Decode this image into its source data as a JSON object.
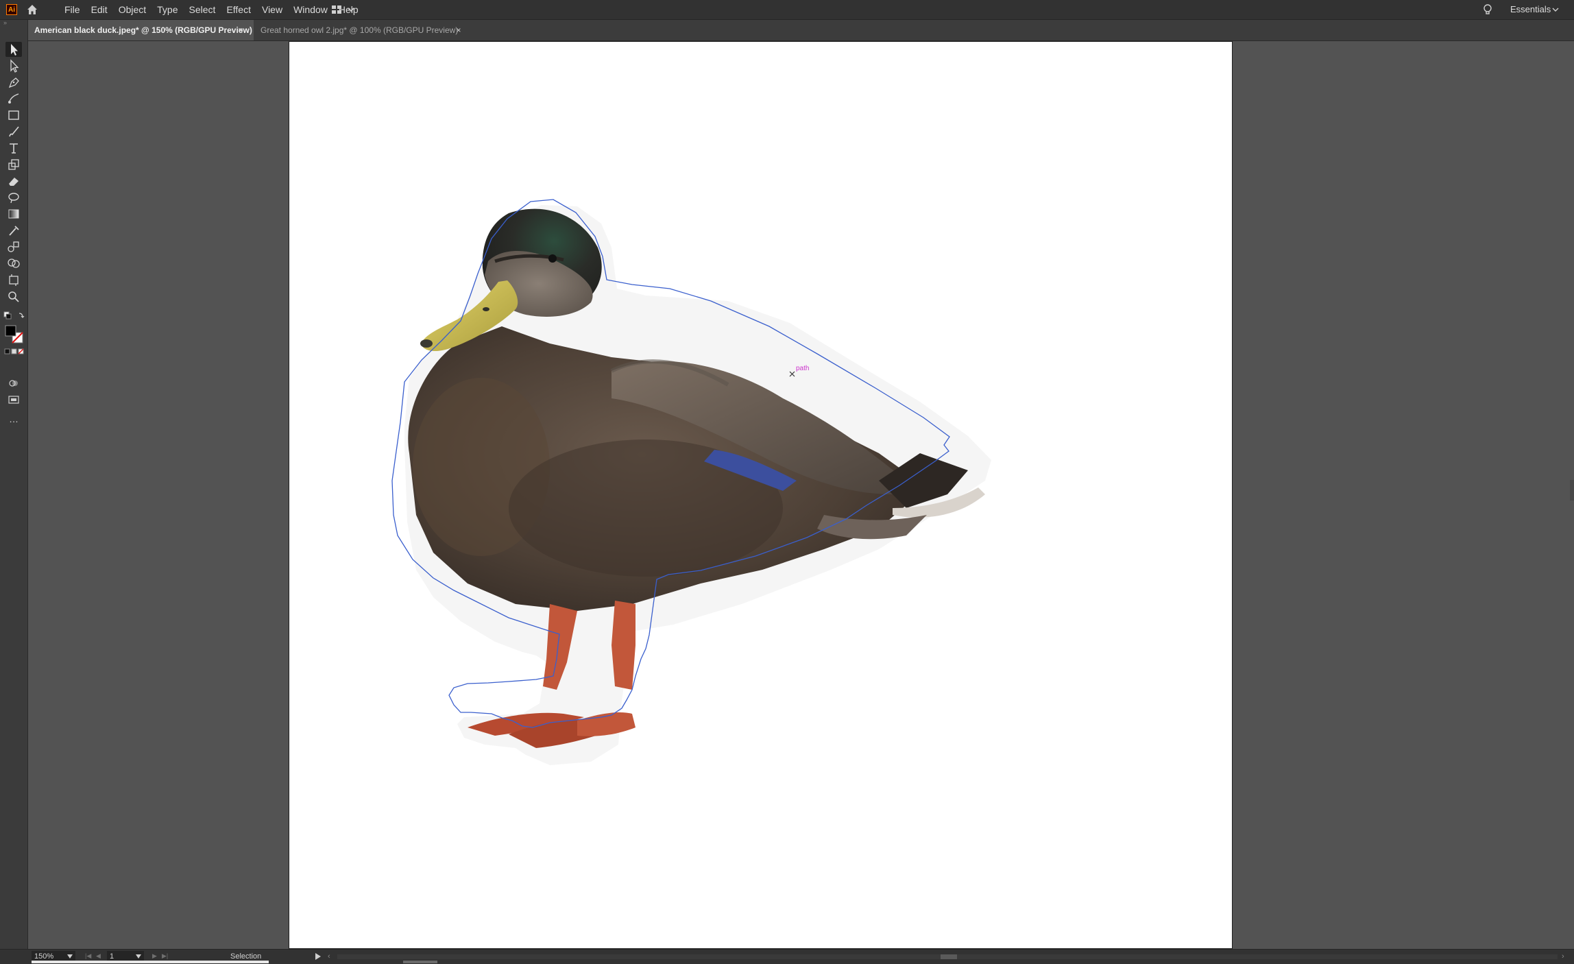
{
  "app": {
    "logo_text": "Ai",
    "workspace": "Essentials"
  },
  "menu": [
    "File",
    "Edit",
    "Object",
    "Type",
    "Select",
    "Effect",
    "View",
    "Window",
    "Help"
  ],
  "tabs": [
    {
      "label": "American black duck.jpeg* @ 150% (RGB/GPU Preview)",
      "active": true,
      "close": "×"
    },
    {
      "label": "Great horned owl 2.jpg* @ 100% (RGB/GPU Preview)",
      "active": false,
      "close": "×"
    }
  ],
  "toolbar": {
    "grip": "»",
    "tools": [
      "selection-tool-icon",
      "direct-selection-tool-icon",
      "pen-tool-icon",
      "curvature-tool-icon",
      "rectangle-tool-icon",
      "paintbrush-tool-icon",
      "type-tool-icon",
      "scale-tool-icon",
      "eraser-tool-icon",
      "lasso-tool-icon",
      "gradient-tool-icon",
      "eyedropper-tool-icon",
      "blend-tool-icon",
      "shape-builder-tool-icon",
      "artboard-tool-icon",
      "zoom-tool-icon"
    ],
    "active_tool": "selection-tool-icon",
    "edit_toolbar": "…"
  },
  "canvas": {
    "hover_label": "path",
    "hover_label_color": "#cc33cc",
    "path_outline_color": "#3a5fcd"
  },
  "status": {
    "zoom": "150%",
    "page": "1",
    "tool": "Selection"
  }
}
